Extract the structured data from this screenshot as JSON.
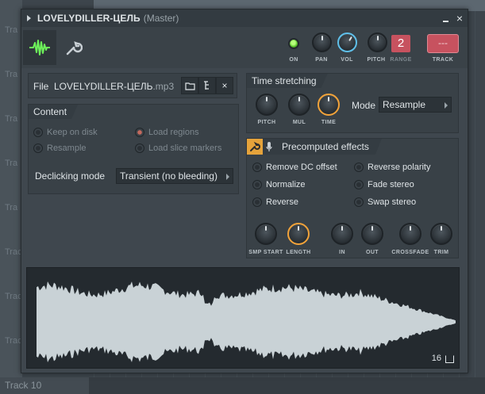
{
  "window": {
    "title": "LOVELYDILLER-ЦЕЛЬ",
    "subtitle": "(Master)",
    "close_glyph": "×"
  },
  "background": {
    "track_labels": [
      "Tra",
      "Tra",
      "Tra",
      "Tra",
      "Tra",
      "Trac",
      "Track",
      "Track",
      "Tra"
    ],
    "bottom_track": "Track 10"
  },
  "toolbar": {
    "on_label": "ON",
    "pan_label": "PAN",
    "vol_label": "VOL",
    "pitch_label": "PITCH",
    "range_label": "RANGE",
    "range_value": "2",
    "track_label": "TRACK",
    "track_value": "---"
  },
  "file": {
    "label": "File",
    "name": "LOVELYDILLER-ЦЕЛЬ",
    "ext": ".mp3",
    "close_glyph": "×"
  },
  "content": {
    "title": "Content",
    "options": {
      "keep_on_disk": "Keep on disk",
      "load_regions": "Load regions",
      "resample": "Resample",
      "load_slice_markers": "Load slice markers"
    },
    "declicking_label": "Declicking mode",
    "declicking_value": "Transient (no bleeding)"
  },
  "time_stretching": {
    "title": "Time stretching",
    "pitch_label": "PITCH",
    "mul_label": "MUL",
    "time_label": "TIME",
    "mode_label": "Mode",
    "mode_value": "Resample"
  },
  "precomputed": {
    "title": "Precomputed effects",
    "options": {
      "remove_dc": "Remove DC offset",
      "reverse_polarity": "Reverse polarity",
      "normalize": "Normalize",
      "fade_stereo": "Fade stereo",
      "reverse": "Reverse",
      "swap_stereo": "Swap stereo"
    },
    "knobs": {
      "smp_start": "SMP START",
      "length": "LENGTH",
      "in": "IN",
      "out": "OUT",
      "crossfade": "CROSSFADE",
      "trim": "TRIM"
    }
  },
  "waveform": {
    "zoom_value": "16"
  },
  "colors": {
    "accent_orange": "#f2a33a",
    "accent_blue": "#5fc0ea",
    "wave_fill": "#c9d2d6",
    "led_green": "#58c22a",
    "track_red": "#c7525f"
  }
}
